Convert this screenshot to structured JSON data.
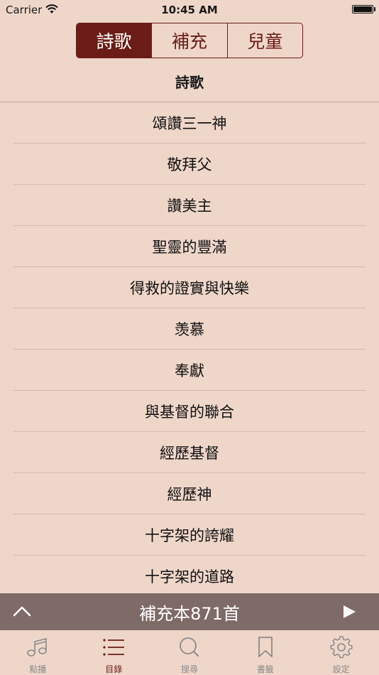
{
  "status_bar": {
    "carrier": "Carrier",
    "time": "10:45 AM"
  },
  "segments": [
    {
      "label": "詩歌",
      "active": true
    },
    {
      "label": "補充",
      "active": false
    },
    {
      "label": "兒童",
      "active": false
    }
  ],
  "page_title": "詩歌",
  "list_items": [
    "頌讚三一神",
    "敬拜父",
    "讚美主",
    "聖靈的豐滿",
    "得救的證實與快樂",
    "羡慕",
    "奉獻",
    "與基督的聯合",
    "經歷基督",
    "經歷神",
    "十字架的誇耀",
    "十字架的道路"
  ],
  "player": {
    "title": "補充本871首"
  },
  "tabs": [
    {
      "label": "點播",
      "icon": "music-note-icon",
      "active": false
    },
    {
      "label": "目錄",
      "icon": "list-icon",
      "active": true
    },
    {
      "label": "搜尋",
      "icon": "search-icon",
      "active": false
    },
    {
      "label": "書籤",
      "icon": "bookmark-icon",
      "active": false
    },
    {
      "label": "設定",
      "icon": "gear-icon",
      "active": false
    }
  ],
  "colors": {
    "accent": "#6b1c16",
    "background": "#eed6c9",
    "player_bar": "#7e6a66",
    "inactive_tab": "#8a8a8a"
  }
}
